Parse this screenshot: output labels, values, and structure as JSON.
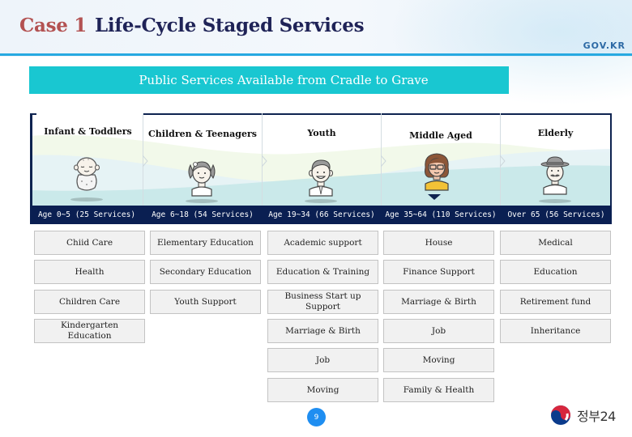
{
  "header": {
    "case_label": "Case 1",
    "title": "Life-Cycle Staged Services",
    "brand": "GOV.KR"
  },
  "banner": {
    "text": "Public Services Available from Cradle to Grave"
  },
  "colors": {
    "title_case": "#b35252",
    "title_main": "#1f2357",
    "banner_bg": "#19c7d1",
    "age_bar_bg": "#0a1f52",
    "rule": "#27a9e1",
    "page_badge": "#1f8ef1"
  },
  "stages": [
    {
      "name": "Infant & Toddlers",
      "icon": "baby-icon",
      "age": "Age 0~5 (25 Services)",
      "services": [
        "Chiid Care",
        "Health",
        "Children Care",
        "Kindergarten Education"
      ]
    },
    {
      "name": "Children & Teenagers",
      "icon": "girl-icon",
      "age": "Age 6~18 (54 Services)",
      "services": [
        "Elementary Education",
        "Secondary Education",
        "Youth Support"
      ]
    },
    {
      "name": "Youth",
      "icon": "young-man-icon",
      "age": "Age 19~34 (66 Services)",
      "services": [
        "Academic support",
        "Education & Training",
        "Business Start up Support",
        "Marriage & Birth",
        "Job",
        "Moving"
      ]
    },
    {
      "name": "Middle Aged",
      "icon": "woman-glasses-icon",
      "age": "Age 35~64 (110 Services)",
      "selected": true,
      "services": [
        "House",
        "Finance  Support",
        "Marriage & Birth",
        "Job",
        "Moving",
        "Family & Health"
      ]
    },
    {
      "name": "Elderly",
      "icon": "old-man-hat-icon",
      "age": "Over 65 (56 Services)",
      "services": [
        "Medical",
        "Education",
        "Retirement  fund",
        "Inheritance"
      ]
    }
  ],
  "footer": {
    "page_number": "9",
    "logo_text": "정부24",
    "logo_icon": "taegeuk-icon"
  }
}
